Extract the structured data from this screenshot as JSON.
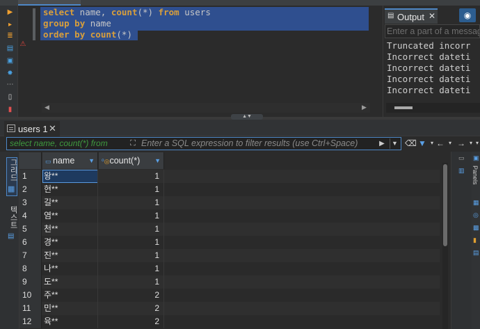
{
  "editor": {
    "lines": [
      {
        "kw1": "select",
        "rest1": " name, ",
        "kw2": "count",
        "rest2": "(*) ",
        "kw3": "from",
        "rest3": " users"
      },
      {
        "kw1": "group",
        "rest1": " ",
        "kw2": "by",
        "rest2": " name"
      },
      {
        "kw1": "order",
        "rest1": " ",
        "kw2": "by",
        "rest2": " ",
        "kw3": "count",
        "rest3": "(*)"
      }
    ]
  },
  "output": {
    "tab_label": "Output",
    "search_placeholder": "Enter a part of a message",
    "lines": [
      "Truncated incorr",
      "Incorrect dateti",
      "Incorrect dateti",
      "Incorrect dateti",
      "Incorrect dateti"
    ]
  },
  "results": {
    "tab_label": "users 1",
    "filter_query": "select name, count(*) from",
    "filter_placeholder": "Enter a SQL expression to filter results (use Ctrl+Space)",
    "vtab_grid": "그리드",
    "vtab_text": "텍스트",
    "columns": [
      "name",
      "count(*)"
    ],
    "rows": [
      {
        "n": "1",
        "name": "왕**",
        "count": "1"
      },
      {
        "n": "2",
        "name": "현**",
        "count": "1"
      },
      {
        "n": "3",
        "name": "길**",
        "count": "1"
      },
      {
        "n": "4",
        "name": "염**",
        "count": "1"
      },
      {
        "n": "5",
        "name": "천**",
        "count": "1"
      },
      {
        "n": "6",
        "name": "경**",
        "count": "1"
      },
      {
        "n": "7",
        "name": "진**",
        "count": "1"
      },
      {
        "n": "8",
        "name": "나**",
        "count": "1"
      },
      {
        "n": "9",
        "name": "도**",
        "count": "1"
      },
      {
        "n": "10",
        "name": "주**",
        "count": "2"
      },
      {
        "n": "11",
        "name": "민**",
        "count": "2"
      },
      {
        "n": "12",
        "name": "육**",
        "count": "2"
      }
    ],
    "right_panel_label": "Panels"
  },
  "colors": {
    "accent": "#4e88c7",
    "keyword": "#d99f3b",
    "selection": "#2f4f8f"
  }
}
